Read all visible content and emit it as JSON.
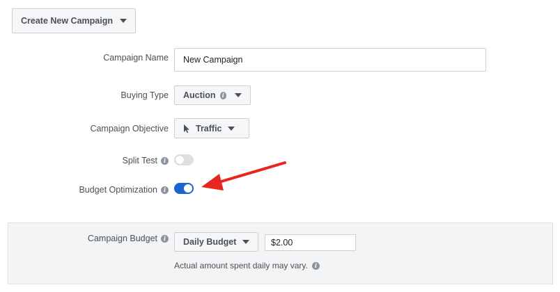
{
  "header": {
    "create_label": "Create New Campaign"
  },
  "form": {
    "campaign_name_label": "Campaign Name",
    "campaign_name_value": "New Campaign",
    "buying_type_label": "Buying Type",
    "buying_type_value": "Auction",
    "objective_label": "Campaign Objective",
    "objective_value": "Traffic",
    "split_test_label": "Split Test",
    "split_test_on": false,
    "budget_opt_label": "Budget Optimization",
    "budget_opt_on": true
  },
  "budget": {
    "label": "Campaign Budget",
    "type_value": "Daily Budget",
    "amount_value": "$2.00",
    "note": "Actual amount spent daily may vary."
  },
  "icons": {
    "info": "i"
  },
  "colors": {
    "toggle_on": "#1b63d0",
    "annotation_arrow": "#e8251e"
  }
}
